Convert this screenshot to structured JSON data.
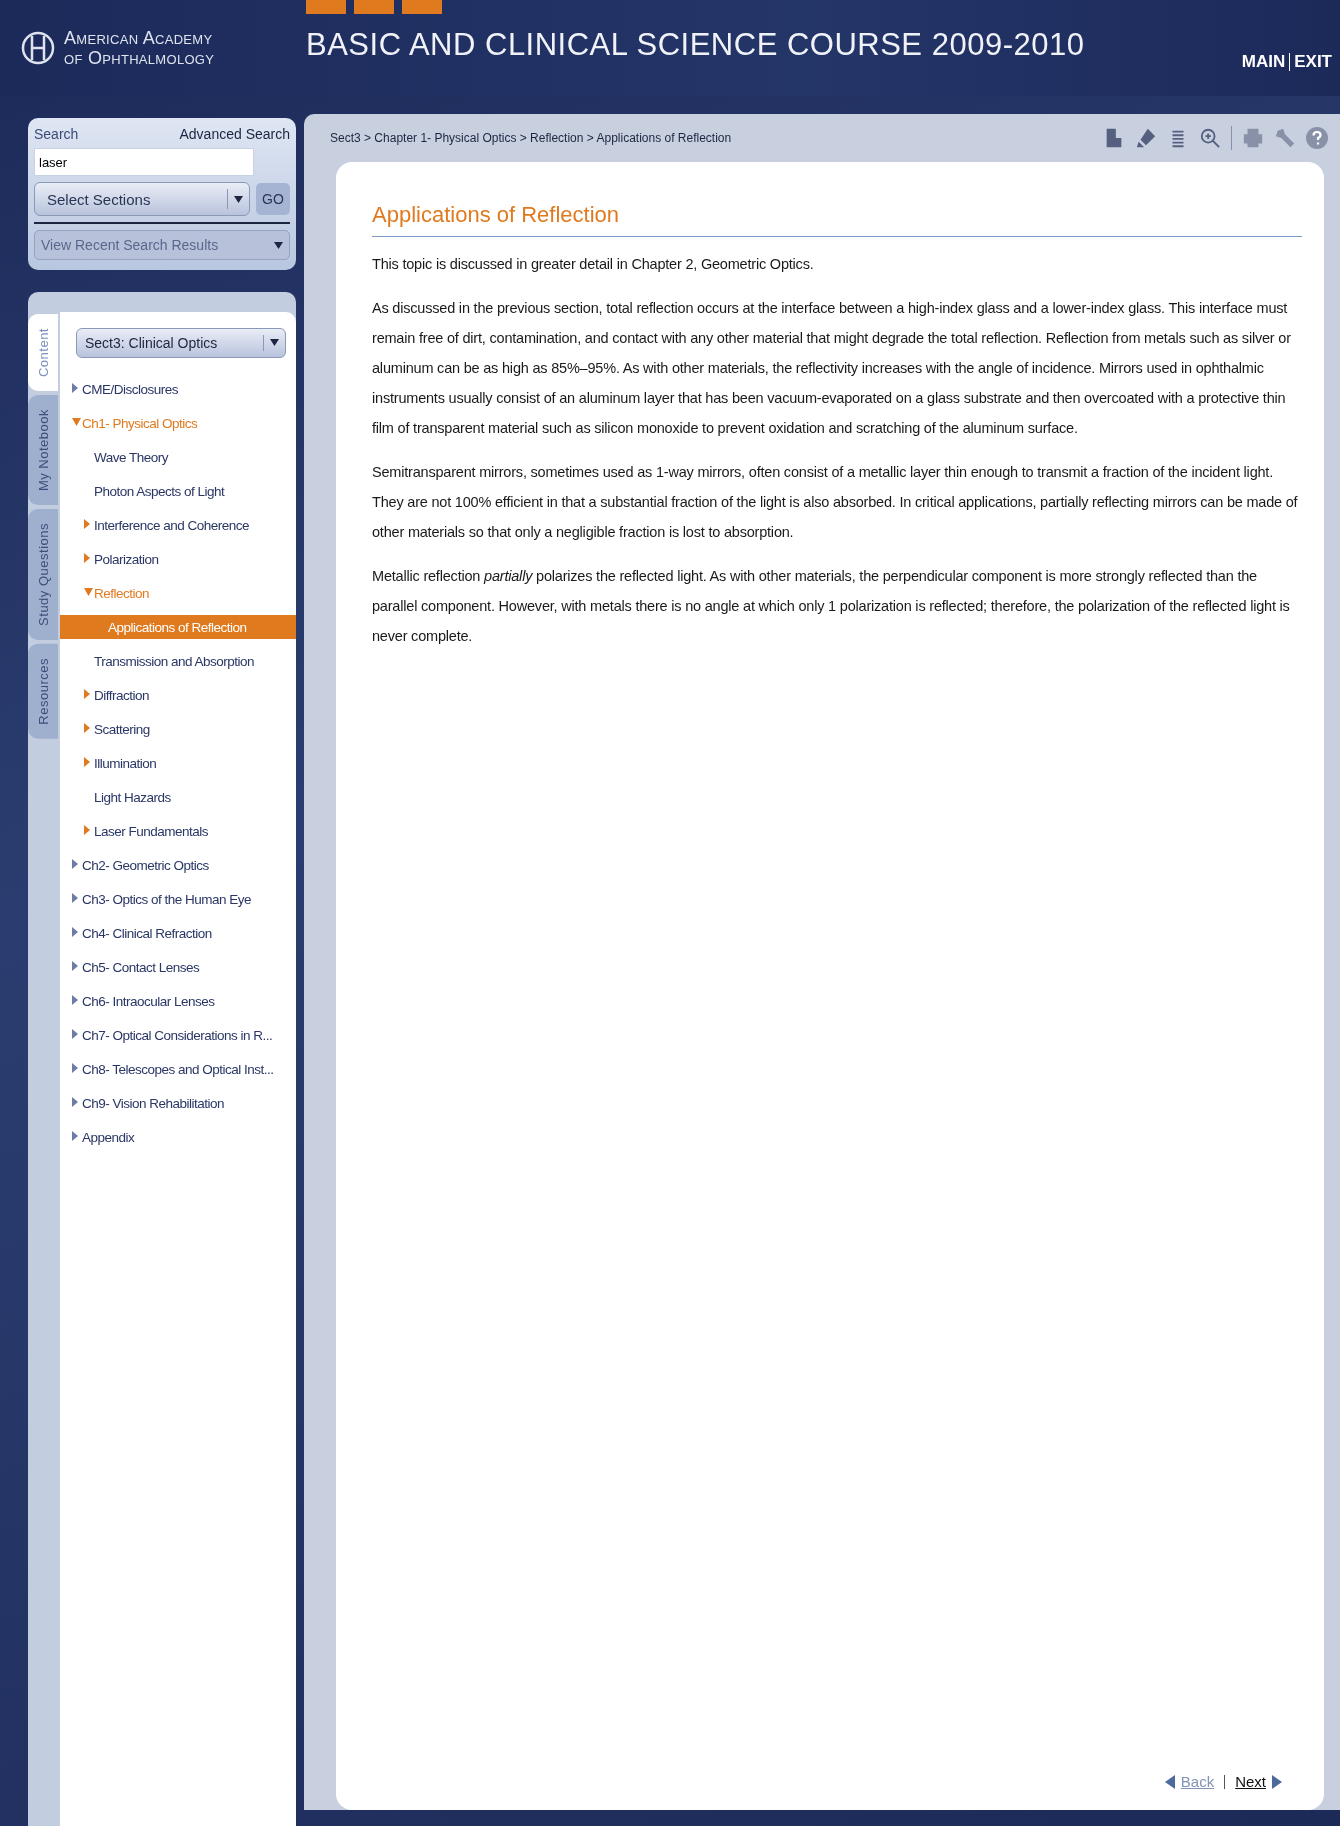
{
  "header": {
    "logo_line1": "American Academy",
    "logo_line2": "of Ophthalmology",
    "title": "BASIC AND CLINICAL SCIENCE COURSE 2009-2010",
    "links": [
      "MAIN",
      "EXIT"
    ]
  },
  "search": {
    "label": "Search",
    "advanced_link": "Advanced Search",
    "value": "laser",
    "sections_select": "Select Sections",
    "go_button": "GO",
    "recent_select": "View Recent Search Results"
  },
  "side_tabs": [
    {
      "label": "Content",
      "selected": true
    },
    {
      "label": "My Notebook",
      "selected": false
    },
    {
      "label": "Study Questions",
      "selected": false
    },
    {
      "label": "Resources",
      "selected": false
    }
  ],
  "section_select": "Sect3: Clinical Optics",
  "tree": [
    {
      "label": "CME/Disclosures",
      "expanded": false,
      "selected": false
    },
    {
      "label": "Ch1- Physical Optics",
      "expanded": true,
      "selected": false,
      "children": [
        {
          "label": "Wave Theory",
          "selected": false
        },
        {
          "label": "Photon Aspects of Light",
          "selected": false
        },
        {
          "label": "Interference and Coherence",
          "expanded": false,
          "selected": false
        },
        {
          "label": "Polarization",
          "expanded": false,
          "selected": false
        },
        {
          "label": "Reflection",
          "expanded": true,
          "selected": false,
          "children": [
            {
              "label": "Applications of Reflection",
              "selected": true
            }
          ]
        },
        {
          "label": "Transmission and Absorption",
          "selected": false
        },
        {
          "label": "Diffraction",
          "expanded": false,
          "selected": false
        },
        {
          "label": "Scattering",
          "expanded": false,
          "selected": false
        },
        {
          "label": "Illumination",
          "expanded": false,
          "selected": false
        },
        {
          "label": "Light Hazards",
          "selected": false
        },
        {
          "label": "Laser Fundamentals",
          "expanded": false,
          "selected": false
        }
      ]
    },
    {
      "label": "Ch2- Geometric Optics",
      "expanded": false,
      "selected": false
    },
    {
      "label": "Ch3- Optics of the Human Eye",
      "expanded": false,
      "selected": false
    },
    {
      "label": "Ch4- Clinical Refraction",
      "expanded": false,
      "selected": false
    },
    {
      "label": "Ch5- Contact Lenses",
      "expanded": false,
      "selected": false
    },
    {
      "label": "Ch6- Intraocular Lenses",
      "expanded": false,
      "selected": false
    },
    {
      "label": "Ch7- Optical Considerations in R...",
      "expanded": false,
      "selected": false
    },
    {
      "label": "Ch8- Telescopes and Optical Inst...",
      "expanded": false,
      "selected": false
    },
    {
      "label": "Ch9- Vision Rehabilitation",
      "expanded": false,
      "selected": false
    },
    {
      "label": "Appendix",
      "expanded": false,
      "selected": false
    }
  ],
  "breadcrumb": "Sect3 > Chapter 1- Physical Optics > Reflection > Applications of Reflection",
  "article": {
    "title": "Applications of Reflection",
    "paragraphs": [
      "This topic is discussed in greater detail in Chapter 2, Geometric Optics.",
      "As discussed in the previous section, total reflection occurs at the interface between a high-index glass and a lower-index glass. This interface must remain free of dirt, contamination, and contact with any other material that might degrade the total reflection. Reflection from metals such as silver or aluminum can be as high as 85%–95%. As with other materials, the reflectivity increases with the angle of incidence. Mirrors used in ophthalmic instruments usually consist of an aluminum layer that has been vacuum-evaporated on a glass substrate and then overcoated with a protective thin film of transparent material such as silicon monoxide to prevent oxidation and scratching of the aluminum surface.",
      "Semitransparent mirrors, sometimes used as 1-way mirrors, often consist of a metallic layer thin enough to transmit a fraction of the incident light. They are not 100% efficient in that a substantial fraction of the light is also absorbed. In critical applications, partially reflecting mirrors can be made of other materials so that only a negligible fraction is lost to absorption.",
      "Metallic reflection *partially* polarizes the reflected light. As with other materials, the perpendicular component is more strongly reflected than the parallel component. However, with metals there is no angle at which only 1 polarization is reflected; therefore, the polarization of the reflected light is never complete."
    ]
  },
  "nav": {
    "back": "Back",
    "next": "Next"
  }
}
